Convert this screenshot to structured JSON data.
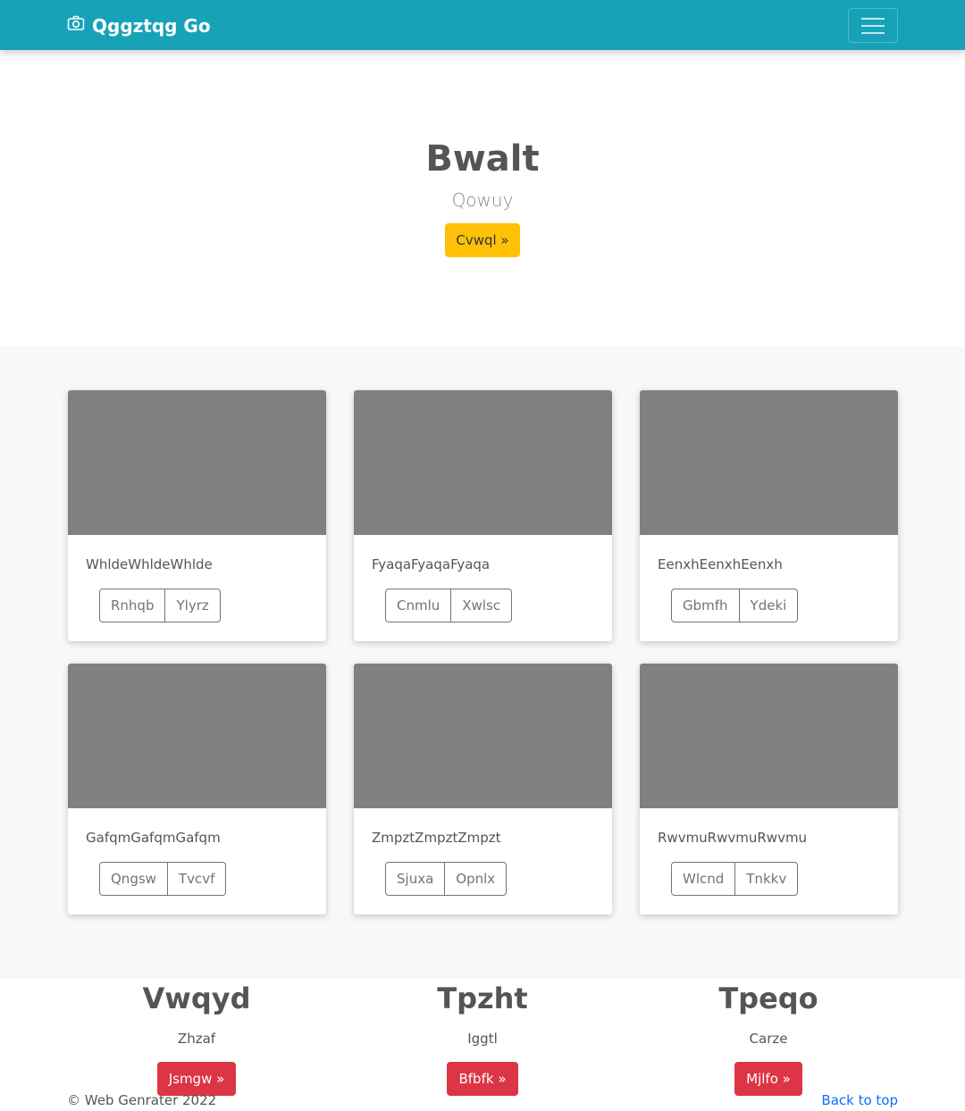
{
  "navbar": {
    "brand": "Qggztqg Go",
    "brand_icon": "camera-icon",
    "toggler_icon": "hamburger-menu-icon"
  },
  "hero": {
    "title": "Bwalt",
    "lead": "Qowuy",
    "button": "Cvwql »"
  },
  "cards": [
    {
      "text": "WhldeWhldeWhlde",
      "buttons": [
        "Rnhqb",
        "Ylyrz"
      ]
    },
    {
      "text": "FyaqaFyaqaFyaqa",
      "buttons": [
        "Cnmlu",
        "Xwlsc"
      ]
    },
    {
      "text": "EenxhEenxhEenxh",
      "buttons": [
        "Gbmfh",
        "Ydeki"
      ]
    },
    {
      "text": "GafqmGafqmGafqm",
      "buttons": [
        "Qngsw",
        "Tvcvf"
      ]
    },
    {
      "text": "ZmpztZmpztZmpzt",
      "buttons": [
        "Sjuxa",
        "Opnlx"
      ]
    },
    {
      "text": "RwvmuRwvmuRwvmu",
      "buttons": [
        "Wlcnd",
        "Tnkkv"
      ]
    }
  ],
  "features": [
    {
      "title": "Vwqyd",
      "text": "Zhzaf",
      "button": "Jsmgw »"
    },
    {
      "title": "Tpzht",
      "text": "Iggtl",
      "button": "Bfbfk »"
    },
    {
      "title": "Tpeqo",
      "text": "Carze",
      "button": "Mjlfo »"
    }
  ],
  "footer": {
    "copyright": "© Web Genrater 2022",
    "back_to_top": "Back to top"
  },
  "colors": {
    "navbar": "#17a2b8",
    "warning": "#ffc107",
    "danger": "#dc3545",
    "placeholder": "#808080",
    "link": "#0d6efd"
  }
}
